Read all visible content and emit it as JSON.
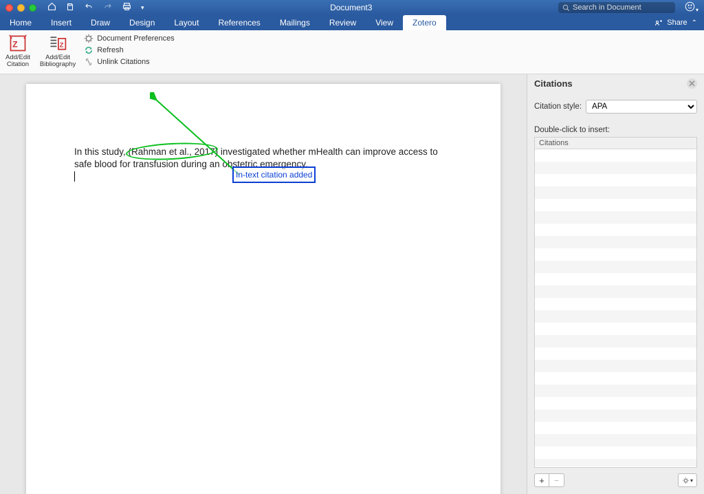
{
  "titlebar": {
    "document_title": "Document3",
    "search_placeholder": "Search in Document"
  },
  "menubar": {
    "tabs": [
      {
        "label": "Home"
      },
      {
        "label": "Insert"
      },
      {
        "label": "Draw"
      },
      {
        "label": "Design"
      },
      {
        "label": "Layout"
      },
      {
        "label": "References"
      },
      {
        "label": "Mailings"
      },
      {
        "label": "Review"
      },
      {
        "label": "View"
      },
      {
        "label": "Zotero"
      }
    ],
    "active_tab": "Zotero",
    "share_label": "Share"
  },
  "ribbon": {
    "add_edit_citation": {
      "line1": "Add/Edit",
      "line2": "Citation"
    },
    "add_edit_bibliography": {
      "line1": "Add/Edit",
      "line2": "Bibliography"
    },
    "document_preferences": "Document Preferences",
    "refresh": "Refresh",
    "unlink_citations": "Unlink Citations"
  },
  "document": {
    "text_before": "In this study, ",
    "citation_text": "(Rahman et al., 2017)",
    "text_after": " investigated whether mHealth can improve access to safe blood for transfusion during an obstetric emergency.",
    "annotation_label": "In-text citation added"
  },
  "sidepanel": {
    "title": "Citations",
    "style_label": "Citation style:",
    "style_value": "APA",
    "insert_label": "Double-click to insert:",
    "list_header": "Citations",
    "add_symbol": "+",
    "remove_symbol": "−",
    "gear_symbol": "✲▾"
  }
}
